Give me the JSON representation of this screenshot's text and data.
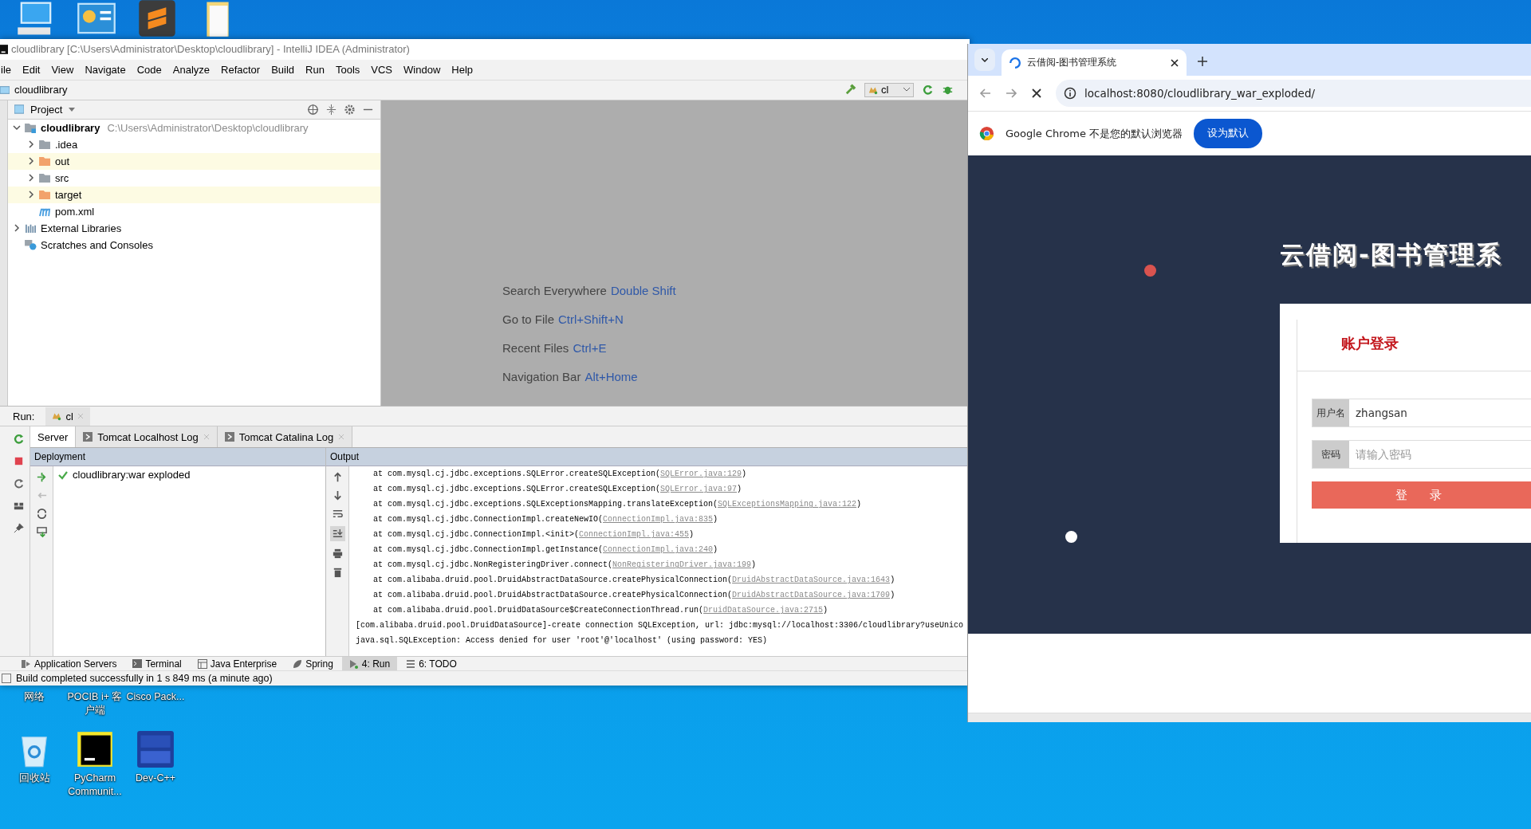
{
  "desktop": {
    "labels_row": [
      {
        "label": "网络"
      },
      {
        "label": "POCIB i+ 客户端"
      },
      {
        "label": "Cisco Pack..."
      }
    ],
    "icons": [
      {
        "kind": "recycle-bin",
        "label": "回收站"
      },
      {
        "kind": "pycharm",
        "label": "PyCharm Communit..."
      },
      {
        "kind": "devcpp",
        "label": "Dev-C++"
      }
    ]
  },
  "ide": {
    "title": "cloudlibrary [C:\\Users\\Administrator\\Desktop\\cloudlibrary] - IntelliJ IDEA (Administrator)",
    "menu": [
      "ile",
      "Edit",
      "View",
      "Navigate",
      "Code",
      "Analyze",
      "Refactor",
      "Build",
      "Run",
      "Tools",
      "VCS",
      "Window",
      "Help"
    ],
    "breadcrumb": "cloudlibrary",
    "run_config": "cl",
    "project_panel": {
      "title": "Project",
      "tree": [
        {
          "label": "cloudlibrary",
          "path": "C:\\Users\\Administrator\\Desktop\\cloudlibrary",
          "kind": "module",
          "expanded": true,
          "children": [
            {
              "label": ".idea",
              "kind": "folder",
              "expanded": false,
              "excluded": false
            },
            {
              "label": "out",
              "kind": "folder",
              "expanded": false,
              "excluded": true
            },
            {
              "label": "src",
              "kind": "folder",
              "expanded": false,
              "excluded": false
            },
            {
              "label": "target",
              "kind": "folder",
              "expanded": false,
              "excluded": true
            },
            {
              "label": "pom.xml",
              "kind": "maven"
            }
          ]
        },
        {
          "label": "External Libraries",
          "kind": "libraries",
          "expanded": false
        },
        {
          "label": "Scratches and Consoles",
          "kind": "scratches"
        }
      ]
    },
    "editor_hints": [
      {
        "label": "Search Everywhere",
        "shortcut": "Double Shift"
      },
      {
        "label": "Go to File",
        "shortcut": "Ctrl+Shift+N"
      },
      {
        "label": "Recent Files",
        "shortcut": "Ctrl+E"
      },
      {
        "label": "Navigation Bar",
        "shortcut": "Alt+Home"
      }
    ],
    "run_panel": {
      "label": "Run:",
      "config_tab": "cl",
      "tabs": [
        {
          "label": "Server",
          "selected": true
        },
        {
          "label": "Tomcat Localhost Log",
          "selected": false
        },
        {
          "label": "Tomcat Catalina Log",
          "selected": false
        }
      ],
      "deployment_header": "Deployment",
      "output_header": "Output",
      "deployments": [
        {
          "name": "cloudlibrary:war exploded",
          "deployed": true
        }
      ],
      "output_lines": [
        {
          "kind": "frame",
          "text": "at com.mysql.cj.jdbc.exceptions.SQLError.createSQLException(",
          "link": "SQLError.java:129",
          "end": ")"
        },
        {
          "kind": "frame",
          "text": "at com.mysql.cj.jdbc.exceptions.SQLError.createSQLException(",
          "link": "SQLError.java:97",
          "end": ")"
        },
        {
          "kind": "frame",
          "text": "at com.mysql.cj.jdbc.exceptions.SQLExceptionsMapping.translateException(",
          "link": "SQLExceptionsMapping.java:122",
          "end": ")"
        },
        {
          "kind": "frame",
          "text": "at com.mysql.cj.jdbc.ConnectionImpl.createNewIO(",
          "link": "ConnectionImpl.java:835",
          "end": ")"
        },
        {
          "kind": "frame",
          "text": "at com.mysql.cj.jdbc.ConnectionImpl.<init>(",
          "link": "ConnectionImpl.java:455",
          "end": ")"
        },
        {
          "kind": "frame",
          "text": "at com.mysql.cj.jdbc.ConnectionImpl.getInstance(",
          "link": "ConnectionImpl.java:240",
          "end": ")"
        },
        {
          "kind": "frame",
          "text": "at com.mysql.cj.jdbc.NonRegisteringDriver.connect(",
          "link": "NonRegisteringDriver.java:199",
          "end": ")"
        },
        {
          "kind": "frame",
          "text": "at com.alibaba.druid.pool.DruidAbstractDataSource.createPhysicalConnection(",
          "link": "DruidAbstractDataSource.java:1643",
          "end": ")"
        },
        {
          "kind": "frame",
          "text": "at com.alibaba.druid.pool.DruidAbstractDataSource.createPhysicalConnection(",
          "link": "DruidAbstractDataSource.java:1709",
          "end": ")"
        },
        {
          "kind": "frame",
          "text": "at com.alibaba.druid.pool.DruidDataSource$CreateConnectionThread.run(",
          "link": "DruidDataSource.java:2715",
          "end": ")"
        },
        {
          "kind": "message",
          "text": "[com.alibaba.druid.pool.DruidDataSource]-create connection SQLException, url: jdbc:mysql://localhost:3306/cloudlibrary?useUnico"
        },
        {
          "kind": "message",
          "text": "java.sql.SQLException: Access denied for user 'root'@'localhost' (using password: YES)"
        }
      ]
    },
    "tool_windows": [
      {
        "label": "Application Servers",
        "kind": "servers",
        "selected": false
      },
      {
        "label": "Terminal",
        "kind": "terminal",
        "selected": false
      },
      {
        "label": "Java Enterprise",
        "kind": "enterprise",
        "selected": false
      },
      {
        "label": "Spring",
        "kind": "spring",
        "selected": false
      },
      {
        "label": "4: Run",
        "kind": "run",
        "selected": true
      },
      {
        "label": "6: TODO",
        "kind": "todo",
        "selected": false
      }
    ],
    "status": "Build completed successfully in 1 s 849 ms (a minute ago)"
  },
  "browser": {
    "tab": {
      "title": "云借阅-图书管理系统",
      "loading": true
    },
    "url": "localhost:8080/cloudlibrary_war_exploded/",
    "infobar": {
      "message": "Google Chrome 不是您的默认浏览器",
      "button": "设为默认"
    },
    "page": {
      "heading": "云借阅-图书管理系",
      "particles": [
        {
          "color": "#d9534f"
        },
        {
          "color": "#ffffff"
        }
      ],
      "login": {
        "title": "账户登录",
        "fields": [
          {
            "label": "用户名",
            "value": "zhangsan"
          },
          {
            "label": "密码",
            "placeholder": "请输入密码"
          }
        ],
        "button": "登 录"
      }
    }
  }
}
